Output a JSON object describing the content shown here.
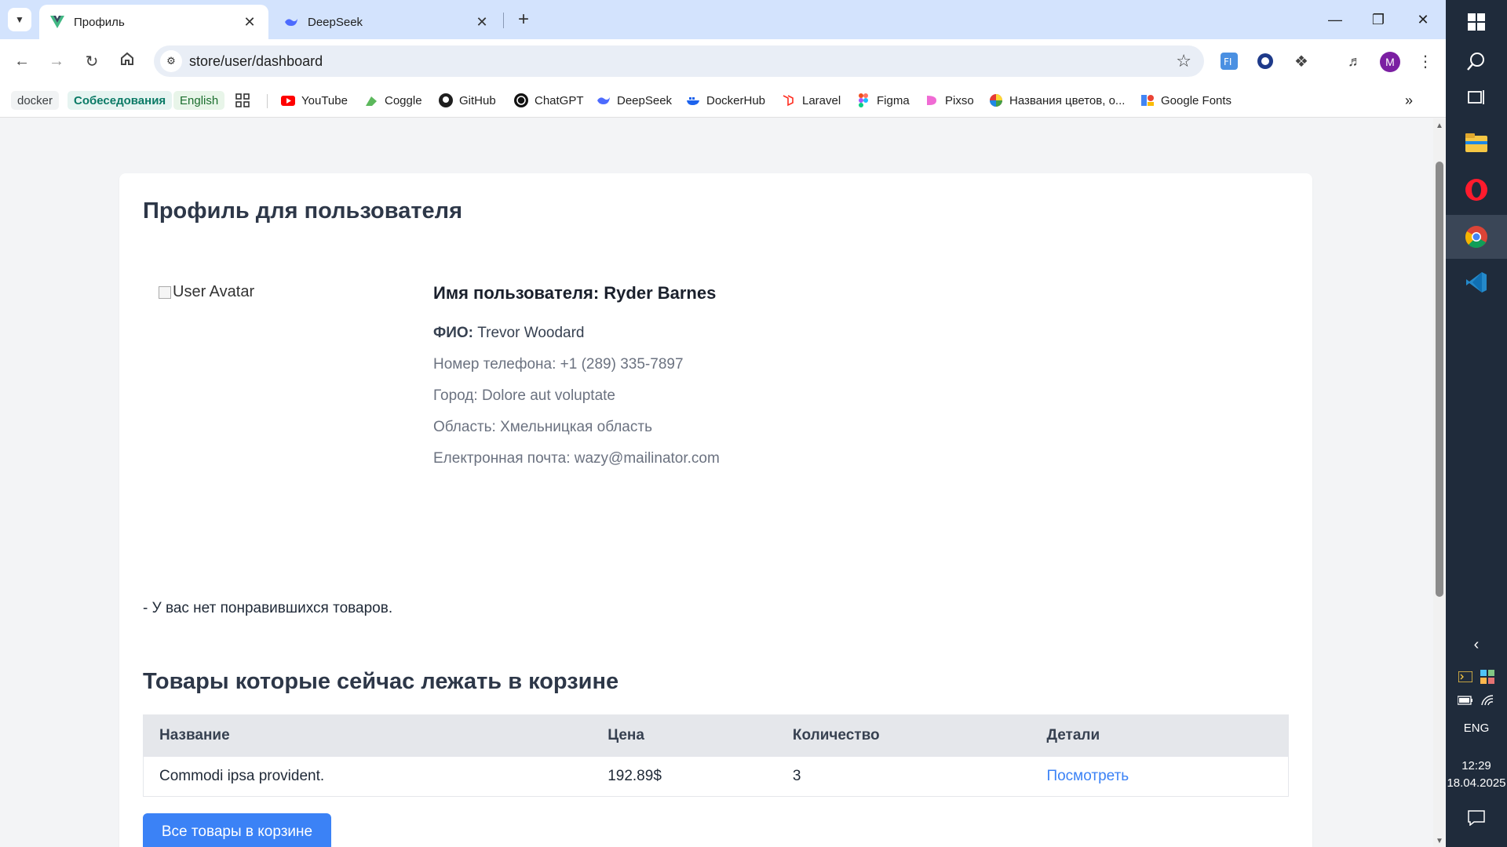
{
  "browser": {
    "tabs": [
      {
        "title": "Профиль",
        "active": true
      },
      {
        "title": "DeepSeek",
        "active": false
      }
    ],
    "url": "store/user/dashboard",
    "profile_initial": "M",
    "bookmarks": {
      "chips": [
        "docker",
        "Собеседования",
        "English"
      ],
      "links": [
        "YouTube",
        "Coggle",
        "GitHub",
        "ChatGPT",
        "DeepSeek",
        "DockerHub",
        "Laravel",
        "Figma",
        "Pixso",
        "Названия цветов, о...",
        "Google Fonts"
      ]
    }
  },
  "page": {
    "profile_heading": "Профиль для пользователя",
    "avatar_alt": "User Avatar",
    "username_label": "Имя пользователя: Ryder Barnes",
    "fio_label": "ФИО:",
    "fio_value": "Trevor Woodard",
    "phone": "Номер телефона: +1 (289) 335-7897",
    "city": "Город: Dolore aut voluptate",
    "region": "Область: Хмельницкая область",
    "email": "Електронная почта: wazy@mailinator.com",
    "no_favorites": "- У вас нет понравившихся товаров.",
    "cart_heading": "Товары которые сейчас лежать в корзине",
    "table": {
      "headers": [
        "Название",
        "Цена",
        "Количество",
        "Детали"
      ],
      "rows": [
        [
          "Commodi ipsa provident.",
          "192.89$",
          "3",
          "Посмотреть"
        ]
      ]
    },
    "all_cart_button": "Все товары в корзине"
  },
  "taskbar": {
    "language": "ENG",
    "time": "12:29",
    "date": "18.04.2025"
  },
  "colors": {
    "accent": "#3b82f6",
    "tabbar": "#d3e3fd",
    "taskbar": "#1f2b3b"
  }
}
